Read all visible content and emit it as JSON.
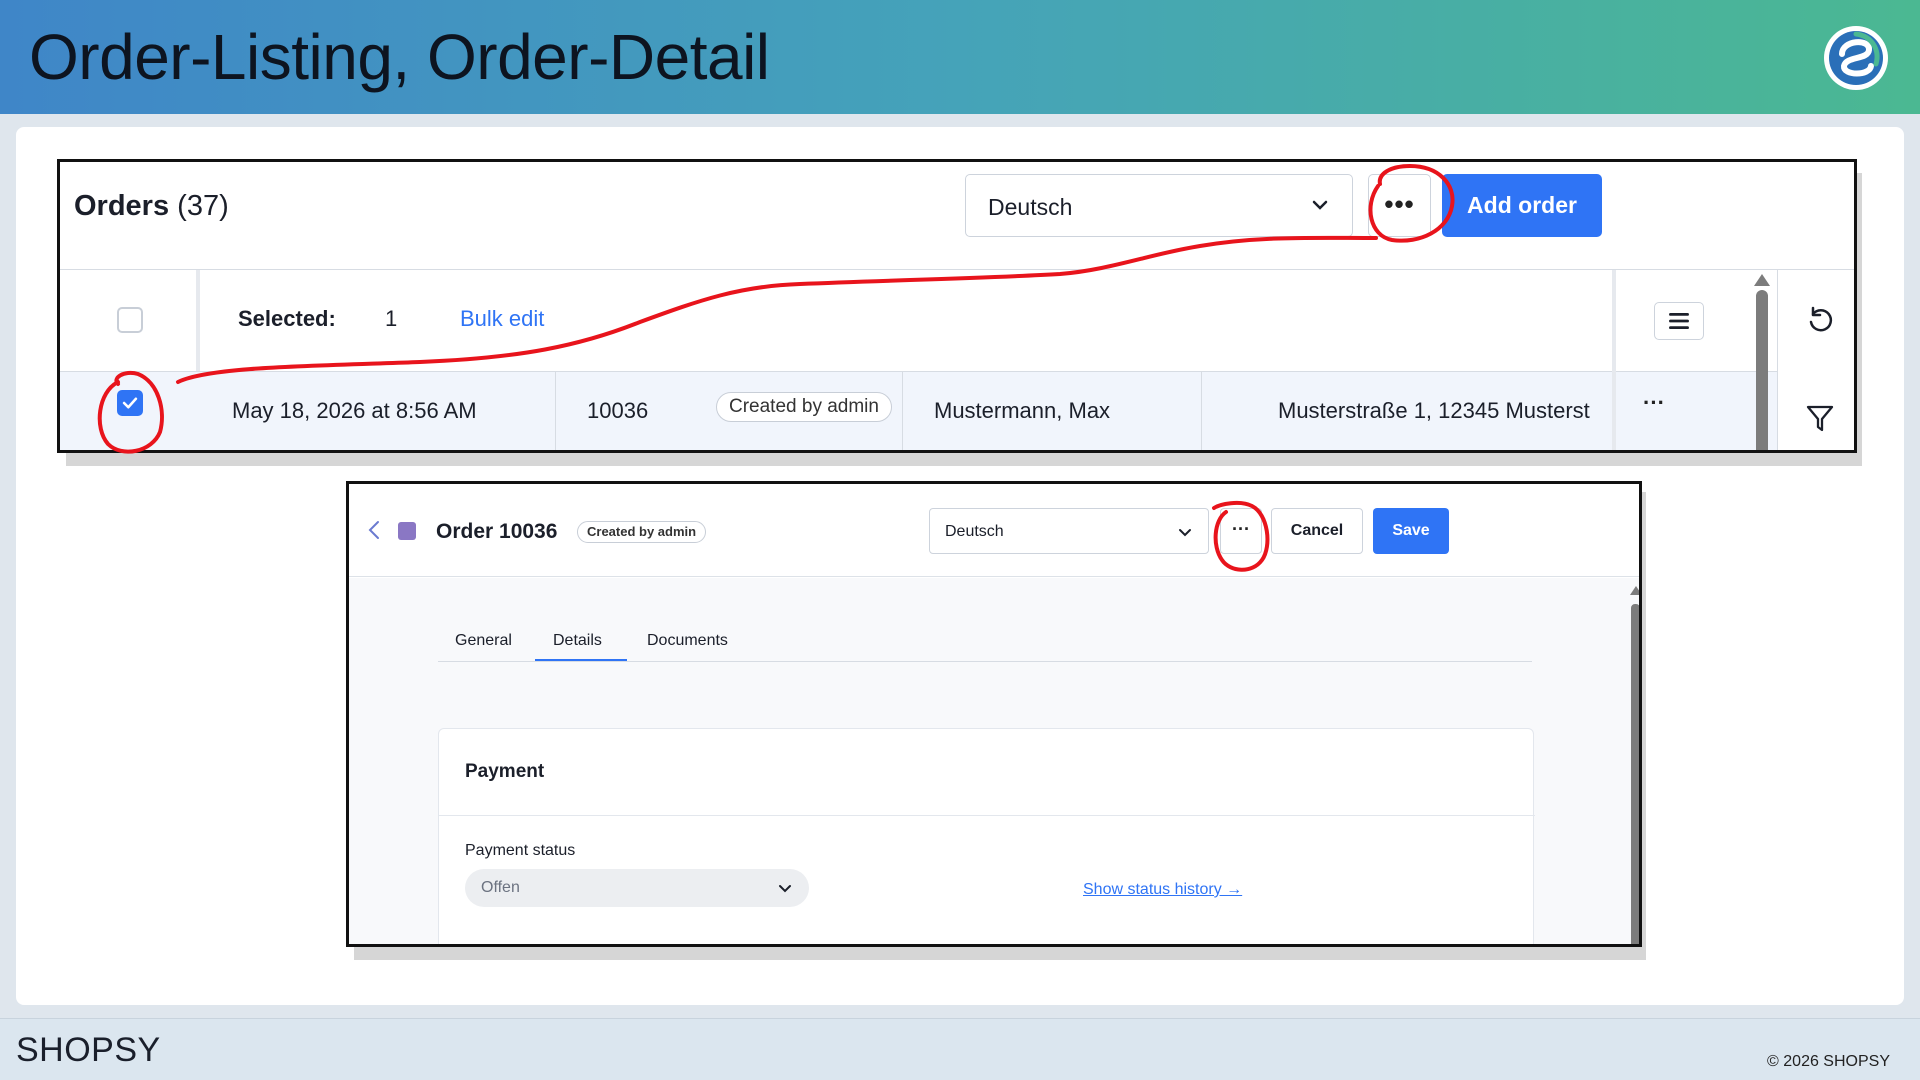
{
  "slide": {
    "title": "Order-Listing, Order-Detail",
    "footer_brand": "SHOPSY",
    "footer_copyright": "© 2026 SHOPSY"
  },
  "orders_listing": {
    "title": "Orders",
    "count": "(37)",
    "language_select": "Deutsch",
    "more_icon": "…",
    "add_order_label": "Add order",
    "selected_label": "Selected:",
    "selected_count": "1",
    "bulk_edit_label": "Bulk edit",
    "row": {
      "date": "May 18, 2026 at 8:56 AM",
      "order_number": "10036",
      "badge": "Created by admin",
      "customer": "Mustermann, Max",
      "address": "Musterstraße 1, 12345 Musterst",
      "row_action": "···"
    }
  },
  "order_detail": {
    "title": "Order 10036",
    "badge": "Created by admin",
    "language_select": "Deutsch",
    "more_label": "···",
    "cancel_label": "Cancel",
    "save_label": "Save",
    "tabs": [
      "General",
      "Details",
      "Documents"
    ],
    "active_tab": "Details",
    "payment": {
      "title": "Payment",
      "status_label": "Payment status",
      "status_value": "Offen",
      "history_link": "Show status history →"
    }
  },
  "colors": {
    "accent": "#2f74f5",
    "annotation": "#e8141c",
    "header_gradient_start": "#3f86c8",
    "header_gradient_end": "#4bb892"
  }
}
